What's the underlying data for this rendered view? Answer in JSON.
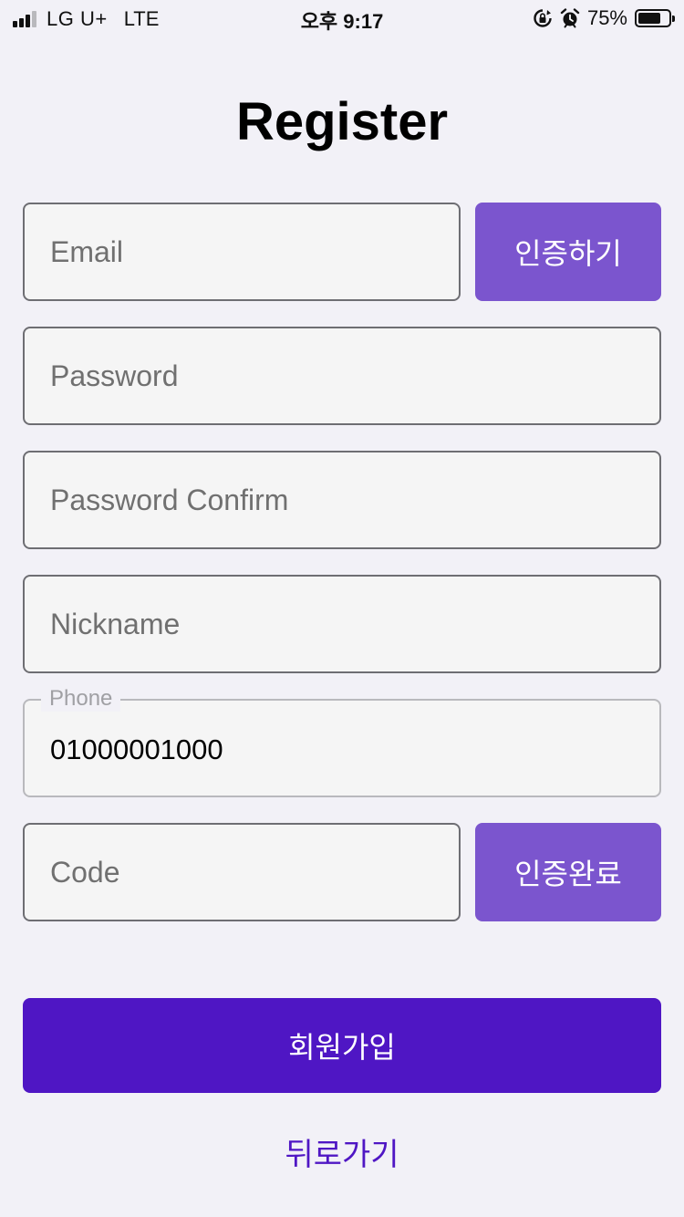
{
  "status_bar": {
    "carrier": "LG U+",
    "network": "LTE",
    "time": "오후 9:17",
    "battery": "75%",
    "battery_level": 0.75,
    "icons": [
      "signal-icon",
      "rotation-lock-icon",
      "alarm-icon",
      "battery-icon"
    ]
  },
  "form": {
    "title": "Register",
    "email": {
      "placeholder": "Email",
      "value": ""
    },
    "verify_button": "인증하기",
    "password": {
      "placeholder": "Password",
      "value": ""
    },
    "password_confirm": {
      "placeholder": "Password Confirm",
      "value": ""
    },
    "nickname": {
      "placeholder": "Nickname",
      "value": ""
    },
    "phone": {
      "label": "Phone",
      "value": "01000001000"
    },
    "code": {
      "placeholder": "Code",
      "value": ""
    },
    "confirm_button": "인증완료",
    "signup_button": "회원가입",
    "back_link": "뒤로가기"
  },
  "colors": {
    "accent": "#7b55ce",
    "primary": "#4f16c4",
    "background": "#f2f1f7",
    "input_bg": "#f5f5f5"
  }
}
